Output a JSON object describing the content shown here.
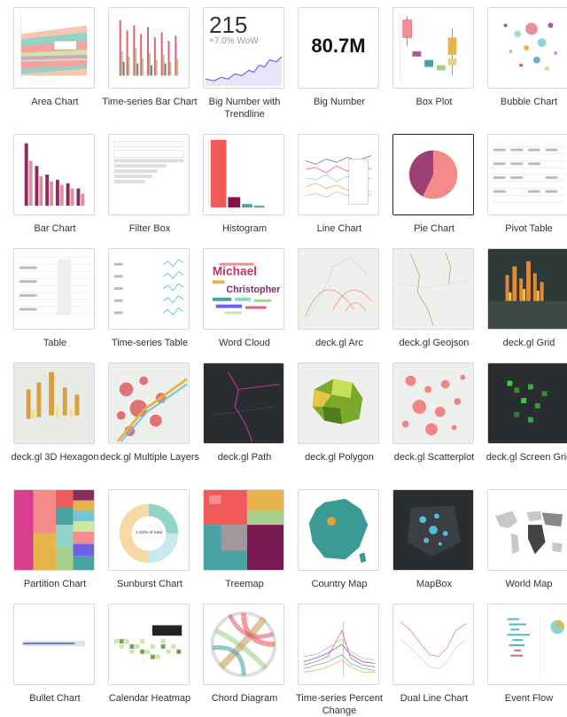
{
  "gallery": {
    "items": [
      {
        "label": "Area Chart"
      },
      {
        "label": "Time-series Bar Chart"
      },
      {
        "label": "Big Number with Trendline",
        "number": "215",
        "sub": "+7.0% WoW"
      },
      {
        "label": "Big Number",
        "number": "80.7M"
      },
      {
        "label": "Box Plot"
      },
      {
        "label": "Bubble Chart"
      },
      {
        "label": "Bar Chart"
      },
      {
        "label": "Filter Box"
      },
      {
        "label": "Histogram"
      },
      {
        "label": "Line Chart"
      },
      {
        "label": "Pie Chart"
      },
      {
        "label": "Pivot Table"
      },
      {
        "label": "Table"
      },
      {
        "label": "Time-series Table"
      },
      {
        "label": "Word Cloud",
        "words": [
          "Michael",
          "Christopher"
        ]
      },
      {
        "label": "deck.gl Arc"
      },
      {
        "label": "deck.gl Geojson"
      },
      {
        "label": "deck.gl Grid"
      },
      {
        "label": "deck.gl 3D Hexagon"
      },
      {
        "label": "deck.gl Multiple Layers"
      },
      {
        "label": "deck.gl Path"
      },
      {
        "label": "deck.gl Polygon"
      },
      {
        "label": "deck.gl Scatterplot"
      },
      {
        "label": "deck.gl Screen Grid"
      },
      {
        "label": "Partition Chart"
      },
      {
        "label": "Sunburst Chart",
        "center": "1.83% of total"
      },
      {
        "label": "Treemap"
      },
      {
        "label": "Country Map"
      },
      {
        "label": "MapBox"
      },
      {
        "label": "World Map"
      },
      {
        "label": "Bullet Chart"
      },
      {
        "label": "Calendar Heatmap"
      },
      {
        "label": "Chord Diagram"
      },
      {
        "label": "Time-series Percent Change"
      },
      {
        "label": "Dual Line Chart"
      },
      {
        "label": "Event Flow"
      }
    ]
  }
}
